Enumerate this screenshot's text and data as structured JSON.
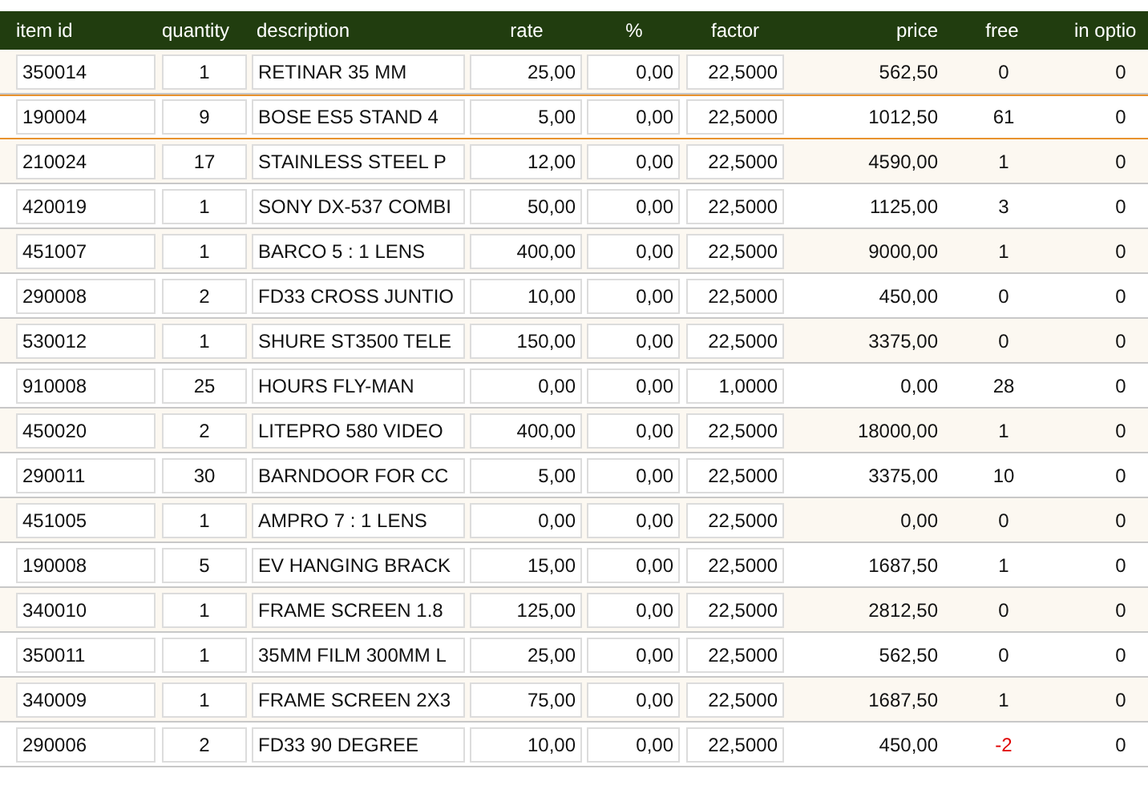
{
  "table": {
    "columns": [
      "item id",
      "quantity",
      "description",
      "rate",
      "%",
      "factor",
      "price",
      "free",
      "in optio"
    ],
    "rows": [
      {
        "item_id": "350014",
        "quantity": "1",
        "description": "RETINAR 35 MM",
        "rate": "25,00",
        "percent": "0,00",
        "factor": "22,5000",
        "price": "562,50",
        "free": "0",
        "in_option": "0",
        "selected": false,
        "shortage": false
      },
      {
        "item_id": "190004",
        "quantity": "9",
        "description": "BOSE ES5 STAND 4",
        "rate": "5,00",
        "percent": "0,00",
        "factor": "22,5000",
        "price": "1012,50",
        "free": "61",
        "in_option": "0",
        "selected": true,
        "shortage": false
      },
      {
        "item_id": "210024",
        "quantity": "17",
        "description": "STAINLESS STEEL P",
        "rate": "12,00",
        "percent": "0,00",
        "factor": "22,5000",
        "price": "4590,00",
        "free": "1",
        "in_option": "0",
        "selected": false,
        "shortage": false
      },
      {
        "item_id": "420019",
        "quantity": "1",
        "description": "SONY DX-537 COMBI",
        "rate": "50,00",
        "percent": "0,00",
        "factor": "22,5000",
        "price": "1125,00",
        "free": "3",
        "in_option": "0",
        "selected": false,
        "shortage": false
      },
      {
        "item_id": "451007",
        "quantity": "1",
        "description": "BARCO 5 : 1 LENS",
        "rate": "400,00",
        "percent": "0,00",
        "factor": "22,5000",
        "price": "9000,00",
        "free": "1",
        "in_option": "0",
        "selected": false,
        "shortage": false
      },
      {
        "item_id": "290008",
        "quantity": "2",
        "description": "FD33 CROSS JUNTIO",
        "rate": "10,00",
        "percent": "0,00",
        "factor": "22,5000",
        "price": "450,00",
        "free": "0",
        "in_option": "0",
        "selected": false,
        "shortage": false
      },
      {
        "item_id": "530012",
        "quantity": "1",
        "description": "SHURE ST3500 TELE",
        "rate": "150,00",
        "percent": "0,00",
        "factor": "22,5000",
        "price": "3375,00",
        "free": "0",
        "in_option": "0",
        "selected": false,
        "shortage": false
      },
      {
        "item_id": "910008",
        "quantity": "25",
        "description": "HOURS FLY-MAN",
        "rate": "0,00",
        "percent": "0,00",
        "factor": "1,0000",
        "price": "0,00",
        "free": "28",
        "in_option": "0",
        "selected": false,
        "shortage": false
      },
      {
        "item_id": "450020",
        "quantity": "2",
        "description": "LITEPRO 580 VIDEO",
        "rate": "400,00",
        "percent": "0,00",
        "factor": "22,5000",
        "price": "18000,00",
        "free": "1",
        "in_option": "0",
        "selected": false,
        "shortage": false
      },
      {
        "item_id": "290011",
        "quantity": "30",
        "description": "BARNDOOR FOR CC",
        "rate": "5,00",
        "percent": "0,00",
        "factor": "22,5000",
        "price": "3375,00",
        "free": "10",
        "in_option": "0",
        "selected": false,
        "shortage": false
      },
      {
        "item_id": "451005",
        "quantity": "1",
        "description": "AMPRO 7 : 1 LENS",
        "rate": "0,00",
        "percent": "0,00",
        "factor": "22,5000",
        "price": "0,00",
        "free": "0",
        "in_option": "0",
        "selected": false,
        "shortage": false
      },
      {
        "item_id": "190008",
        "quantity": "5",
        "description": "EV HANGING BRACK",
        "rate": "15,00",
        "percent": "0,00",
        "factor": "22,5000",
        "price": "1687,50",
        "free": "1",
        "in_option": "0",
        "selected": false,
        "shortage": false
      },
      {
        "item_id": "340010",
        "quantity": "1",
        "description": "FRAME SCREEN 1.8",
        "rate": "125,00",
        "percent": "0,00",
        "factor": "22,5000",
        "price": "2812,50",
        "free": "0",
        "in_option": "0",
        "selected": false,
        "shortage": false
      },
      {
        "item_id": "350011",
        "quantity": "1",
        "description": "35MM FILM 300MM L",
        "rate": "25,00",
        "percent": "0,00",
        "factor": "22,5000",
        "price": "562,50",
        "free": "0",
        "in_option": "0",
        "selected": false,
        "shortage": false
      },
      {
        "item_id": "340009",
        "quantity": "1",
        "description": "FRAME SCREEN 2X3",
        "rate": "75,00",
        "percent": "0,00",
        "factor": "22,5000",
        "price": "1687,50",
        "free": "1",
        "in_option": "0",
        "selected": false,
        "shortage": false
      },
      {
        "item_id": "290006",
        "quantity": "2",
        "description": "FD33 90 DEGREE",
        "rate": "10,00",
        "percent": "0,00",
        "factor": "22,5000",
        "price": "450,00",
        "free": "-2",
        "in_option": "0",
        "selected": false,
        "shortage": true
      }
    ]
  }
}
